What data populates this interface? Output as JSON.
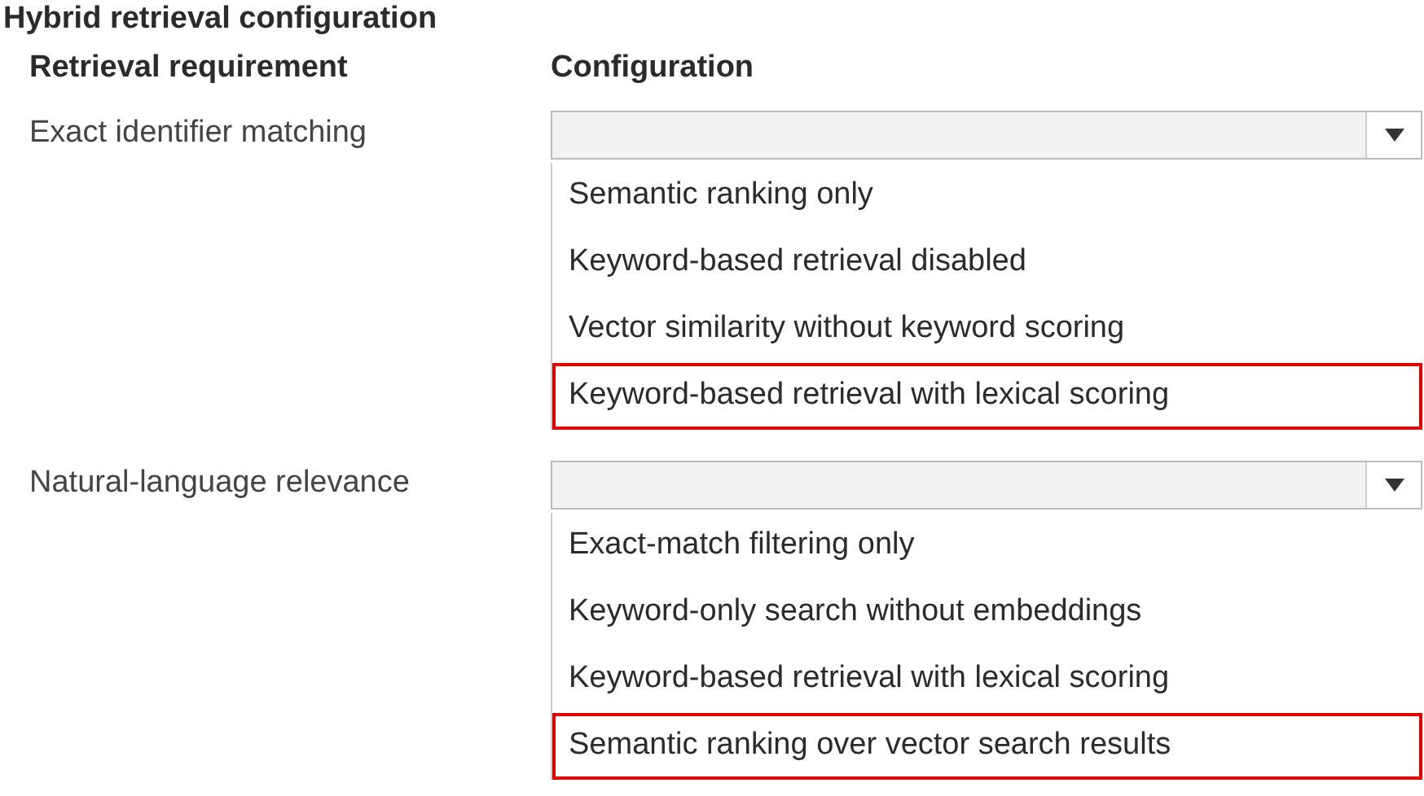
{
  "title": "Hybrid retrieval configuration",
  "columns": [
    "Retrieval requirement",
    "Configuration"
  ],
  "rows": [
    {
      "requirement": "Exact identifier matching",
      "options": [
        {
          "label": "Semantic ranking only",
          "selected": false
        },
        {
          "label": "Keyword-based retrieval disabled",
          "selected": false
        },
        {
          "label": "Vector similarity without keyword scoring",
          "selected": false
        },
        {
          "label": "Keyword-based retrieval with lexical scoring",
          "selected": true
        }
      ]
    },
    {
      "requirement": "Natural-language relevance",
      "options": [
        {
          "label": "Exact-match filtering only",
          "selected": false
        },
        {
          "label": "Keyword-only search without embeddings",
          "selected": false
        },
        {
          "label": "Keyword-based retrieval with lexical scoring",
          "selected": false
        },
        {
          "label": "Semantic ranking over vector search results",
          "selected": true
        }
      ]
    }
  ]
}
